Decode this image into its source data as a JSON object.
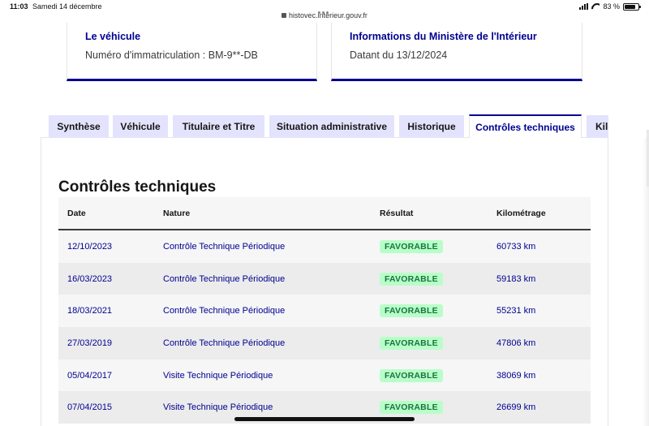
{
  "status_bar": {
    "time": "11:03",
    "date": "Samedi 14 décembre",
    "url": "histovec.interieur.gouv.fr",
    "battery": "83 %",
    "battery_level": 0.83
  },
  "cards": {
    "vehicle": {
      "title": "Le véhicule",
      "text": "Numéro d'immatriculation : BM-9**-DB"
    },
    "ministry": {
      "title": "Informations du Ministère de l'Intérieur",
      "text": "Datant du 13/12/2024"
    }
  },
  "tabs": [
    {
      "label": "Synthèse",
      "active": false
    },
    {
      "label": "Véhicule",
      "active": false
    },
    {
      "label": "Titulaire et Titre",
      "active": false
    },
    {
      "label": "Situation administrative",
      "active": false
    },
    {
      "label": "Historique",
      "active": false
    },
    {
      "label": "Contrôles techniques",
      "active": true
    },
    {
      "label": "Kilo",
      "active": false
    }
  ],
  "section": {
    "title": "Contrôles techniques"
  },
  "table": {
    "headers": {
      "date": "Date",
      "nature": "Nature",
      "result": "Résultat",
      "km": "Kilométrage"
    },
    "rows": [
      {
        "date": "12/10/2023",
        "nature": "Contrôle Technique Périodique",
        "result": "FAVORABLE",
        "km": "60733 km"
      },
      {
        "date": "16/03/2023",
        "nature": "Contrôle Technique Périodique",
        "result": "FAVORABLE",
        "km": "59183 km"
      },
      {
        "date": "18/03/2021",
        "nature": "Contrôle Technique Périodique",
        "result": "FAVORABLE",
        "km": "55231 km"
      },
      {
        "date": "27/03/2019",
        "nature": "Contrôle Technique Périodique",
        "result": "FAVORABLE",
        "km": "47806 km"
      },
      {
        "date": "05/04/2017",
        "nature": "Visite Technique Périodique",
        "result": "FAVORABLE",
        "km": "38069 km"
      },
      {
        "date": "07/04/2015",
        "nature": "Visite Technique Périodique",
        "result": "FAVORABLE",
        "km": "26699 km"
      }
    ]
  },
  "colors": {
    "brand_blue": "#000091",
    "tab_bg": "#e3e3fd",
    "badge_bg": "#b8fec9",
    "badge_text": "#18753c"
  }
}
